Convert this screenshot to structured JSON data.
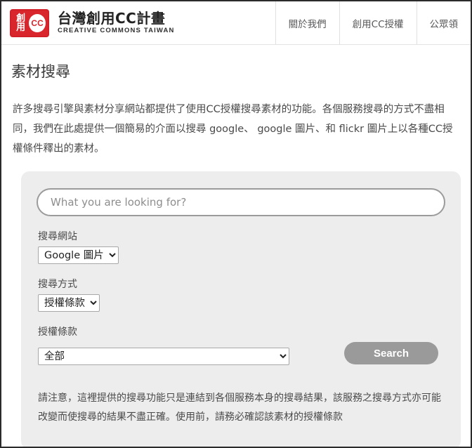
{
  "header": {
    "logo": {
      "mark_chars": "創用",
      "mark_cc": "CC",
      "title": "台灣創用CC計畫",
      "subtitle": "CREATIVE COMMONS TAIWAN"
    },
    "nav": [
      {
        "label": "關於我們"
      },
      {
        "label": "創用CC授權"
      },
      {
        "label": "公眾領"
      }
    ]
  },
  "page": {
    "title": "素材搜尋",
    "intro": "許多搜尋引擎與素材分享網站都提供了使用CC授權搜尋素材的功能。各個服務搜尋的方式不盡相同，我們在此處提供一個簡易的介面以搜尋 google、 google 圖片、和 flickr 圖片上以各種CC授權條件釋出的素材。",
    "note": "請注意，這裡提供的搜尋功能只是連結到各個服務本身的搜尋結果，該服務之搜尋方式亦可能改變而使搜尋的結果不盡正確。使用前，請務必確認該素材的授權條款"
  },
  "form": {
    "query": {
      "value": "",
      "placeholder": "What you are looking for?"
    },
    "site": {
      "label": "搜尋網站",
      "selected": "Google 圖片",
      "options": [
        "Google 圖片"
      ]
    },
    "method": {
      "label": "搜尋方式",
      "selected": "授權條款",
      "options": [
        "授權條款"
      ]
    },
    "license": {
      "label": "授權條款",
      "selected": "全部",
      "options": [
        "全部"
      ]
    },
    "submit_label": "Search"
  },
  "colors": {
    "brand_red": "#d8262c",
    "panel_bg": "#ededed",
    "button_bg": "#9a9a9a",
    "page_border": "#2b2b2b"
  }
}
